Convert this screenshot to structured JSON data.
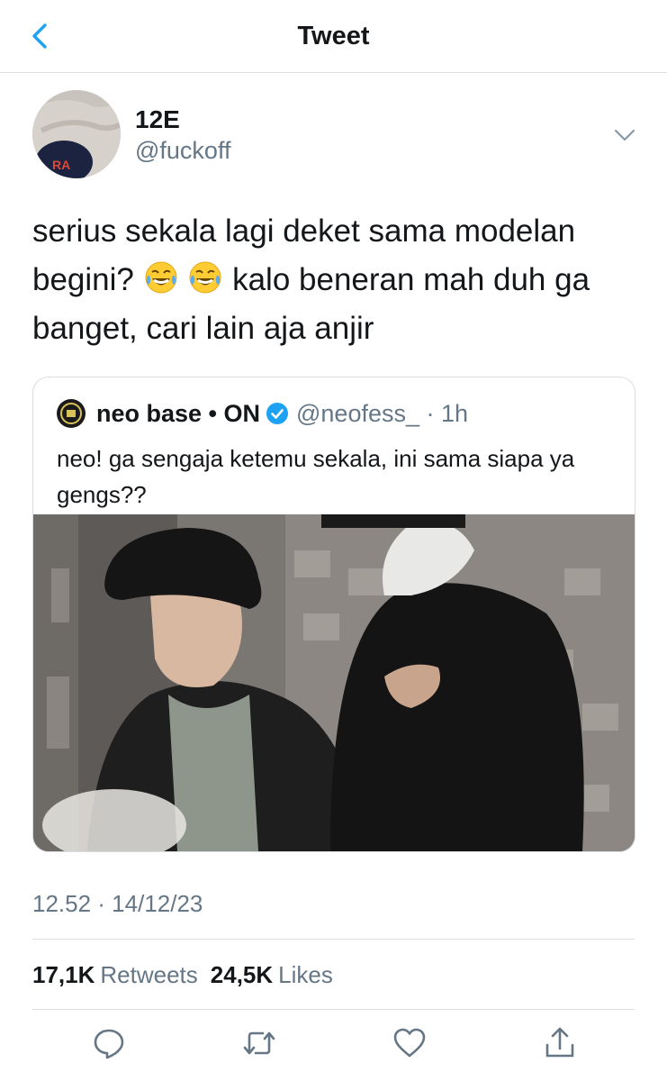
{
  "header": {
    "title": "Tweet",
    "back_icon": "chevron-left-icon"
  },
  "colors": {
    "accent": "#1da1f2",
    "text": "#14171a",
    "muted": "#657786",
    "divider": "#dcdfe2"
  },
  "tweet": {
    "display_name": "12E",
    "handle": "@fuckoff",
    "text_part1": "serius sekala lagi deket sama modelan begini?",
    "emoji": "face-with-tears-of-joy",
    "text_part2": "kalo beneran mah duh ga banget, cari lain aja anjir",
    "timestamp": "12.52 · 14/12/23",
    "retweets_count": "17,1K",
    "retweets_label": "Retweets",
    "likes_count": "24,5K",
    "likes_label": "Likes"
  },
  "quote": {
    "display_name": "neo base • ON",
    "handle_time": "@neofess_ · 1h",
    "text": "neo! ga sengaja ketemu sekala, ini sama siapa ya gengs??",
    "photo": "photo of two people in dark clothing, one wearing a bucket hat, one wearing a face mask"
  },
  "actions": [
    "reply-icon",
    "retweet-icon",
    "like-icon",
    "share-icon"
  ]
}
